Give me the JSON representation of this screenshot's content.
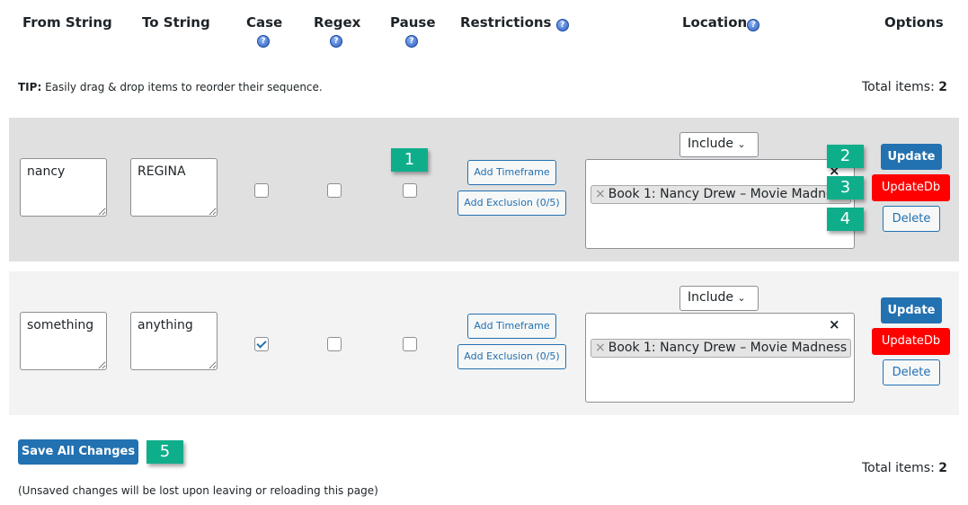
{
  "headers": {
    "from": "From String",
    "to": "To String",
    "case": "Case",
    "regex": "Regex",
    "pause": "Pause",
    "restrictions": "Restrictions",
    "location": "Location",
    "options": "Options"
  },
  "help_icon": "question-circle-icon",
  "tip": {
    "label": "TIP:",
    "text": " Easily drag & drop items to reorder their sequence."
  },
  "total": {
    "label": "Total items: ",
    "count": "2"
  },
  "rows": [
    {
      "from": "nancy",
      "to": "REGINA",
      "case": false,
      "regex": false,
      "pause": false,
      "timeframe": "Add Timeframe",
      "exclusion": "Add Exclusion (0/5)",
      "mode": "Include",
      "tag": "Book 1: Nancy Drew – Movie Madness",
      "clear": "×",
      "update": "Update",
      "updatedb": "UpdateDb",
      "delete": "Delete"
    },
    {
      "from": "something",
      "to": "anything",
      "case": true,
      "regex": false,
      "pause": false,
      "timeframe": "Add Timeframe",
      "exclusion": "Add Exclusion (0/5)",
      "mode": "Include",
      "tag": "Book 1: Nancy Drew – Movie Madness",
      "clear": "×",
      "update": "Update",
      "updatedb": "UpdateDb",
      "delete": "Delete"
    }
  ],
  "badges": [
    "1",
    "2",
    "3",
    "4",
    "5"
  ],
  "save": "Save All Changes",
  "note": "(Unsaved changes will be lost upon leaving or reloading this page)",
  "colors": {
    "primary": "#2271b1",
    "danger": "#ff0000",
    "badge": "#0fae8b"
  }
}
